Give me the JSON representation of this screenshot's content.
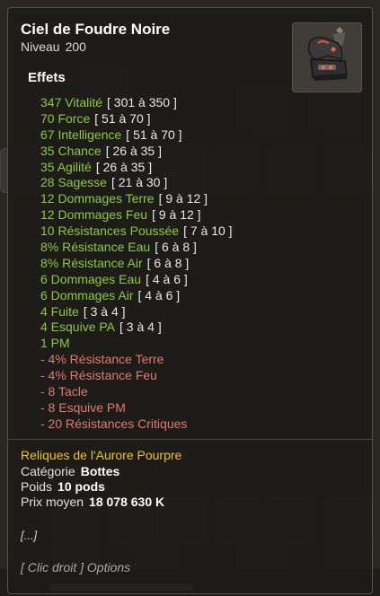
{
  "item": {
    "name": "Ciel de Foudre Noire",
    "level_label": "Niveau",
    "level_value": "200"
  },
  "effects_section_label": "Effets",
  "effects": [
    {
      "text": "347 Vitalité",
      "range": "[ 301 à 350 ]",
      "type": "positive"
    },
    {
      "text": "70 Force",
      "range": "[ 51 à 70 ]",
      "type": "positive"
    },
    {
      "text": "67 Intelligence",
      "range": "[ 51 à 70 ]",
      "type": "positive"
    },
    {
      "text": "35 Chance",
      "range": "[ 26 à 35 ]",
      "type": "positive"
    },
    {
      "text": "35 Agilité",
      "range": "[ 26 à 35 ]",
      "type": "positive"
    },
    {
      "text": "28 Sagesse",
      "range": "[ 21 à 30 ]",
      "type": "positive"
    },
    {
      "text": "12 Dommages Terre",
      "range": "[ 9 à 12 ]",
      "type": "positive"
    },
    {
      "text": "12 Dommages Feu",
      "range": "[ 9 à 12 ]",
      "type": "positive"
    },
    {
      "text": "10 Résistances Poussée",
      "range": "[ 7 à 10 ]",
      "type": "positive"
    },
    {
      "text": "8% Résistance Eau",
      "range": "[ 6 à 8 ]",
      "type": "positive"
    },
    {
      "text": "8% Résistance Air",
      "range": "[ 6 à 8 ]",
      "type": "positive"
    },
    {
      "text": "6 Dommages Eau",
      "range": "[ 4 à 6 ]",
      "type": "positive"
    },
    {
      "text": "6 Dommages Air",
      "range": "[ 4 à 6 ]",
      "type": "positive"
    },
    {
      "text": "4 Fuite",
      "range": "[ 3 à 4 ]",
      "type": "positive"
    },
    {
      "text": "4 Esquive PA",
      "range": "[ 3 à 4 ]",
      "type": "positive"
    },
    {
      "text": "1 PM",
      "range": "",
      "type": "positive"
    },
    {
      "text": "- 4% Résistance Terre",
      "range": "",
      "type": "negative"
    },
    {
      "text": "- 4% Résistance Feu",
      "range": "",
      "type": "negative"
    },
    {
      "text": "- 8 Tacle",
      "range": "",
      "type": "negative"
    },
    {
      "text": "- 8 Esquive PM",
      "range": "",
      "type": "negative"
    },
    {
      "text": "- 20 Résistances Critiques",
      "range": "",
      "type": "negative"
    }
  ],
  "set_name": "Reliques de l'Aurore Pourpre",
  "category": {
    "label": "Catégorie",
    "value": "Bottes"
  },
  "weight": {
    "label": "Poids",
    "value": "10 pods"
  },
  "price": {
    "label": "Prix moyen",
    "value": "18 078 630 K"
  },
  "more_text": "[...]",
  "hint_text": "[ Clic droit ] Options",
  "colors": {
    "positive": "#8ccb3b",
    "negative": "#e0796b",
    "set": "#f2c21b",
    "panel": "#1c1b19"
  },
  "icons": {
    "item_image": "black-boots-icon"
  }
}
